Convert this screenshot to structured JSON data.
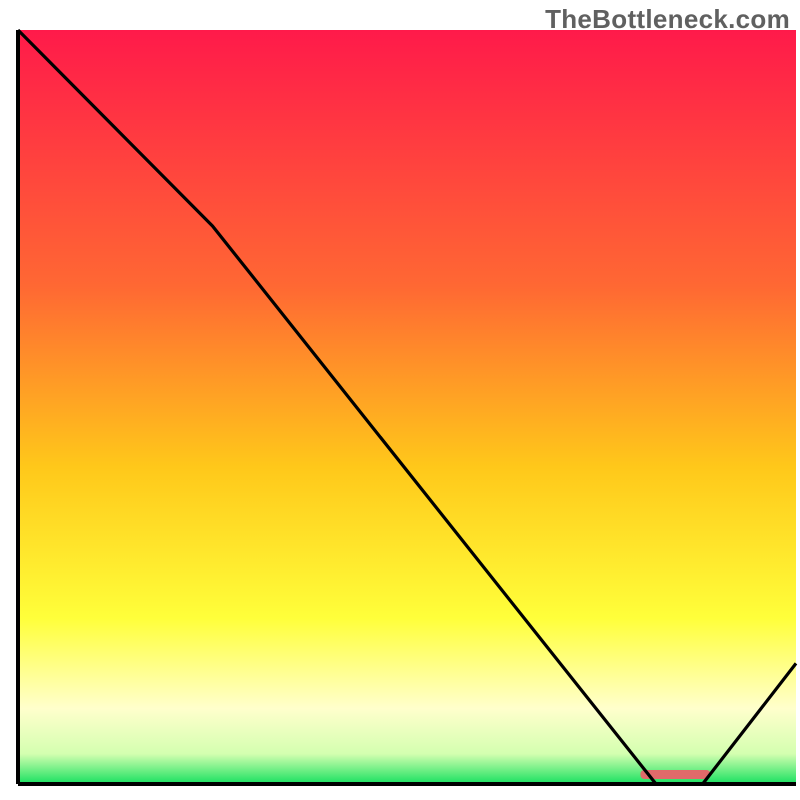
{
  "watermark": "TheBottleneck.com",
  "chart_data": {
    "type": "line",
    "title": "",
    "xlabel": "",
    "ylabel": "",
    "xlim": [
      0,
      100
    ],
    "ylim": [
      0,
      100
    ],
    "x": [
      0,
      25,
      82,
      88,
      100
    ],
    "values": [
      100,
      74,
      0,
      0,
      16
    ],
    "highlight_segment": {
      "x_start": 80,
      "x_end": 89,
      "label": ""
    },
    "gradient_stops": [
      {
        "offset": 0,
        "color": "#ff1a4a"
      },
      {
        "offset": 34,
        "color": "#ff6833"
      },
      {
        "offset": 58,
        "color": "#ffc81a"
      },
      {
        "offset": 78,
        "color": "#ffff3a"
      },
      {
        "offset": 90,
        "color": "#ffffcc"
      },
      {
        "offset": 96,
        "color": "#d4ffb0"
      },
      {
        "offset": 100,
        "color": "#18e060"
      }
    ],
    "axis_color": "#000000",
    "line_color": "#000000",
    "highlight_color": "#e06a6a"
  }
}
